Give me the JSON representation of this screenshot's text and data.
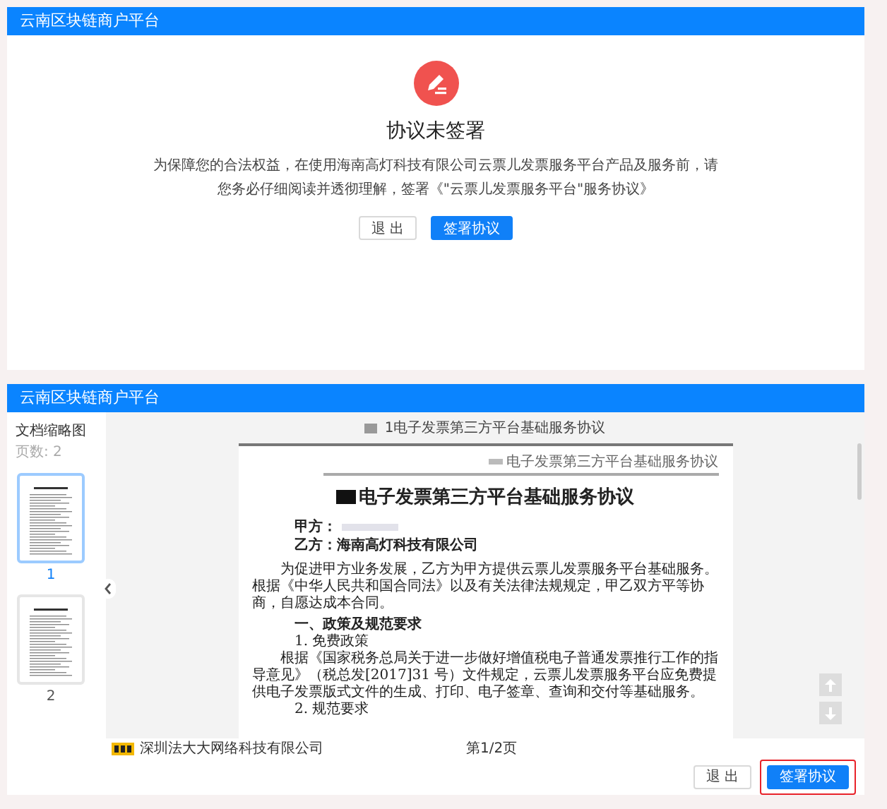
{
  "notice_panel": {
    "header": "云南区块链商户平台",
    "title": "协议未签署",
    "message": "为保障您的合法权益，在使用海南高灯科技有限公司云票儿发票服务平台产品及服务前，请您务必仔细阅读并透彻理解，签署《\"云票儿发票服务平台\"服务协议》",
    "buttons": [
      {
        "label": "退 出",
        "kind": "default"
      },
      {
        "label": "签署协议",
        "kind": "primary"
      }
    ]
  },
  "viewer_panel": {
    "header": "云南区块链商户平台",
    "sidebar": {
      "title": "文档缩略图",
      "page_count": "页数: 2",
      "thumbnails": [
        {
          "label": "1",
          "selected": true
        },
        {
          "label": "2",
          "selected": false
        }
      ]
    },
    "document_title": "1电子发票第三方平台基础服务协议",
    "page": {
      "running_head": "电子发票第三方平台基础服务协议",
      "title": "电子发票第三方平台基础服务协议",
      "party_a": "甲方：",
      "party_b": "乙方：海南高灯科技有限公司",
      "paragraphs": [
        {
          "kind": "body",
          "text": "为促进甲方业务发展，乙方为甲方提供云票儿发票服务平台基础服务。根据《中华人民共和国合同法》以及有关法律法规规定，甲乙双方平等协商，自愿达成本合同。"
        },
        {
          "kind": "heading",
          "text": "一、政策及规范要求"
        },
        {
          "kind": "item",
          "text": "1. 免费政策"
        },
        {
          "kind": "body",
          "text": "根据《国家税务总局关于进一步做好增值税电子普通发票推行工作的指导意见》（税总发[2017]31 号）文件规定，云票儿发票服务平台应免费提供电子发票版式文件的生成、打印、电子签章、查询和交付等基础服务。"
        },
        {
          "kind": "item",
          "text": "2. 规范要求"
        }
      ]
    },
    "footer": {
      "company": "深圳法大大网络科技有限公司",
      "page_indicator": "第1/2页"
    },
    "buttons": [
      {
        "label": "退 出",
        "kind": "default",
        "highlighted": false
      },
      {
        "label": "签署协议",
        "kind": "primary",
        "highlighted": true
      }
    ]
  }
}
